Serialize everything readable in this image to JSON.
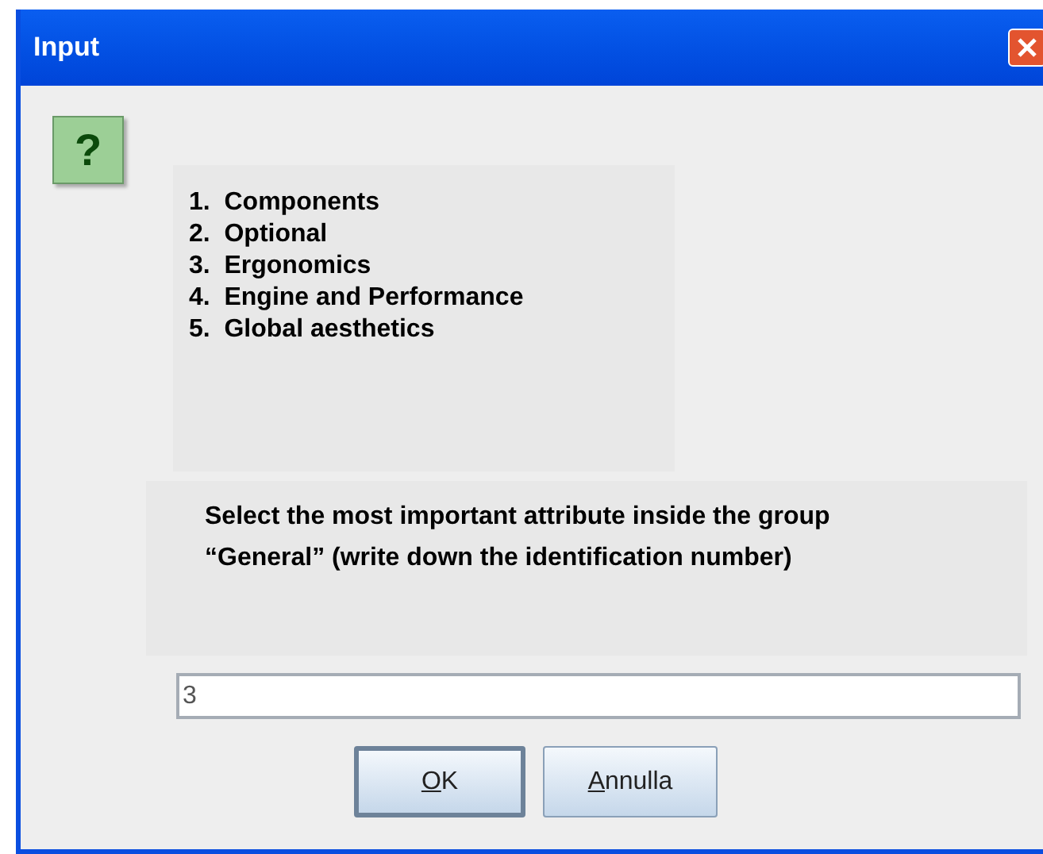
{
  "window": {
    "title": "Input"
  },
  "icon": {
    "glyph": "?"
  },
  "options": [
    "1.  Components",
    "2.  Optional",
    "3.  Ergonomics",
    "4.  Engine and Performance",
    "5.  Global aesthetics"
  ],
  "message": "Select the most important attribute inside the group “General” (write down the identification number)",
  "input": {
    "value": "3"
  },
  "buttons": [
    {
      "label": "OK",
      "default": true
    },
    {
      "label": "Annulla",
      "default": false
    }
  ]
}
